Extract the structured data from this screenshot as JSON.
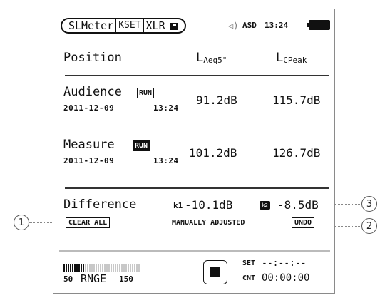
{
  "status_bar": {
    "modes": [
      "SLMeter",
      "KSET",
      "XLR"
    ],
    "save_icon": "save-icon",
    "speaker_icon": "speaker-icon",
    "input_label": "ASD",
    "time": "13:24",
    "battery_icon": "battery-icon"
  },
  "table": {
    "col_position": "Position",
    "col1_main": "L",
    "col1_sub": "Aeq5\"",
    "col2_main": "L",
    "col2_sub": "CPeak",
    "rows": [
      {
        "name": "Audience",
        "tag": "RUN",
        "tag_style": "outline",
        "date": "2011-12-09",
        "time": "13:24",
        "laeq": "91.2dB",
        "lcpeak": "115.7dB"
      },
      {
        "name": "Measure",
        "tag": "RUN",
        "tag_style": "filled",
        "date": "2011-12-09",
        "time": "13:24",
        "laeq": "101.2dB",
        "lcpeak": "126.7dB"
      }
    ]
  },
  "difference": {
    "label": "Difference",
    "k1_label": "k1",
    "k1_value": "-10.1dB",
    "k2_label": "k2",
    "k2_value": "-8.5dB",
    "clear_all": "CLEAR ALL",
    "manually_adjusted": "MANUALLY ADJUSTED",
    "undo": "UNDO"
  },
  "bottom": {
    "range_min": "50",
    "range_label": "RNGE",
    "range_max": "150",
    "meter_level": 0.27,
    "set_label": "SET",
    "set_value": "--:--:--",
    "cnt_label": "CNT",
    "cnt_value": "00:00:00",
    "stop_icon": "stop-icon"
  },
  "callouts": [
    "1",
    "2",
    "3"
  ],
  "colors": {
    "ink": "#111111",
    "frame": "#8a8a8a",
    "meter_off": "#c8c8c8"
  }
}
